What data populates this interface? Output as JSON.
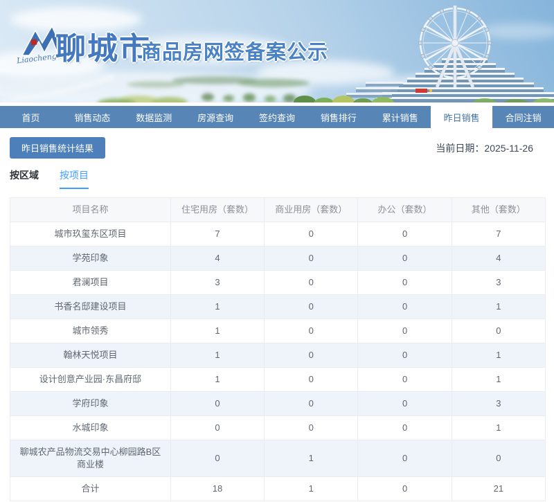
{
  "header": {
    "logo_script": "Liaocheng",
    "title_city": "聊城市",
    "title_main": "商品房网签备案公示"
  },
  "nav": {
    "items": [
      {
        "label": "首页",
        "active": false
      },
      {
        "label": "销售动态",
        "active": false
      },
      {
        "label": "数据监测",
        "active": false
      },
      {
        "label": "房源查询",
        "active": false
      },
      {
        "label": "签约查询",
        "active": false
      },
      {
        "label": "销售排行",
        "active": false
      },
      {
        "label": "累计销售",
        "active": false
      },
      {
        "label": "昨日销售",
        "active": true
      },
      {
        "label": "合同注销",
        "active": false
      }
    ]
  },
  "toolbar": {
    "result_button": "昨日销售统计结果",
    "date_label": "当前日期：",
    "date_value": "2025-11-26"
  },
  "tabs": [
    {
      "label": "按区域",
      "active": false
    },
    {
      "label": "按项目",
      "active": true
    }
  ],
  "table": {
    "columns": [
      "项目名称",
      "住宅用房（套数）",
      "商业用房（套数）",
      "办公（套数）",
      "其他（套数）"
    ],
    "rows": [
      {
        "name": "城市玖玺东区项目",
        "values": [
          "7",
          "0",
          "0",
          "7"
        ]
      },
      {
        "name": "学苑印象",
        "values": [
          "4",
          "0",
          "0",
          "4"
        ]
      },
      {
        "name": "君澜项目",
        "values": [
          "3",
          "0",
          "0",
          "3"
        ]
      },
      {
        "name": "书香名邸建设项目",
        "values": [
          "1",
          "0",
          "0",
          "1"
        ]
      },
      {
        "name": "城市领秀",
        "values": [
          "1",
          "0",
          "0",
          "0"
        ]
      },
      {
        "name": "翰林天悦项目",
        "values": [
          "1",
          "0",
          "0",
          "1"
        ]
      },
      {
        "name": "设计创意产业园·东昌府邸",
        "values": [
          "1",
          "0",
          "0",
          "1"
        ]
      },
      {
        "name": "学府印象",
        "values": [
          "0",
          "0",
          "0",
          "3"
        ]
      },
      {
        "name": "水城印象",
        "values": [
          "0",
          "0",
          "0",
          "1"
        ]
      },
      {
        "name": "聊城农产品物流交易中心柳园路B区商业楼",
        "values": [
          "0",
          "1",
          "0",
          "0"
        ]
      },
      {
        "name": "合计",
        "values": [
          "18",
          "1",
          "0",
          "21"
        ]
      }
    ]
  },
  "colors": {
    "nav_bg": "#5785b6",
    "nav_active_text": "#42719f",
    "button_bg": "#4d7fba",
    "tab_active": "#409eff",
    "stripe_bg": "#eef4fa",
    "table_border": "#e9edf2",
    "banner_title": "#4a82c6"
  }
}
